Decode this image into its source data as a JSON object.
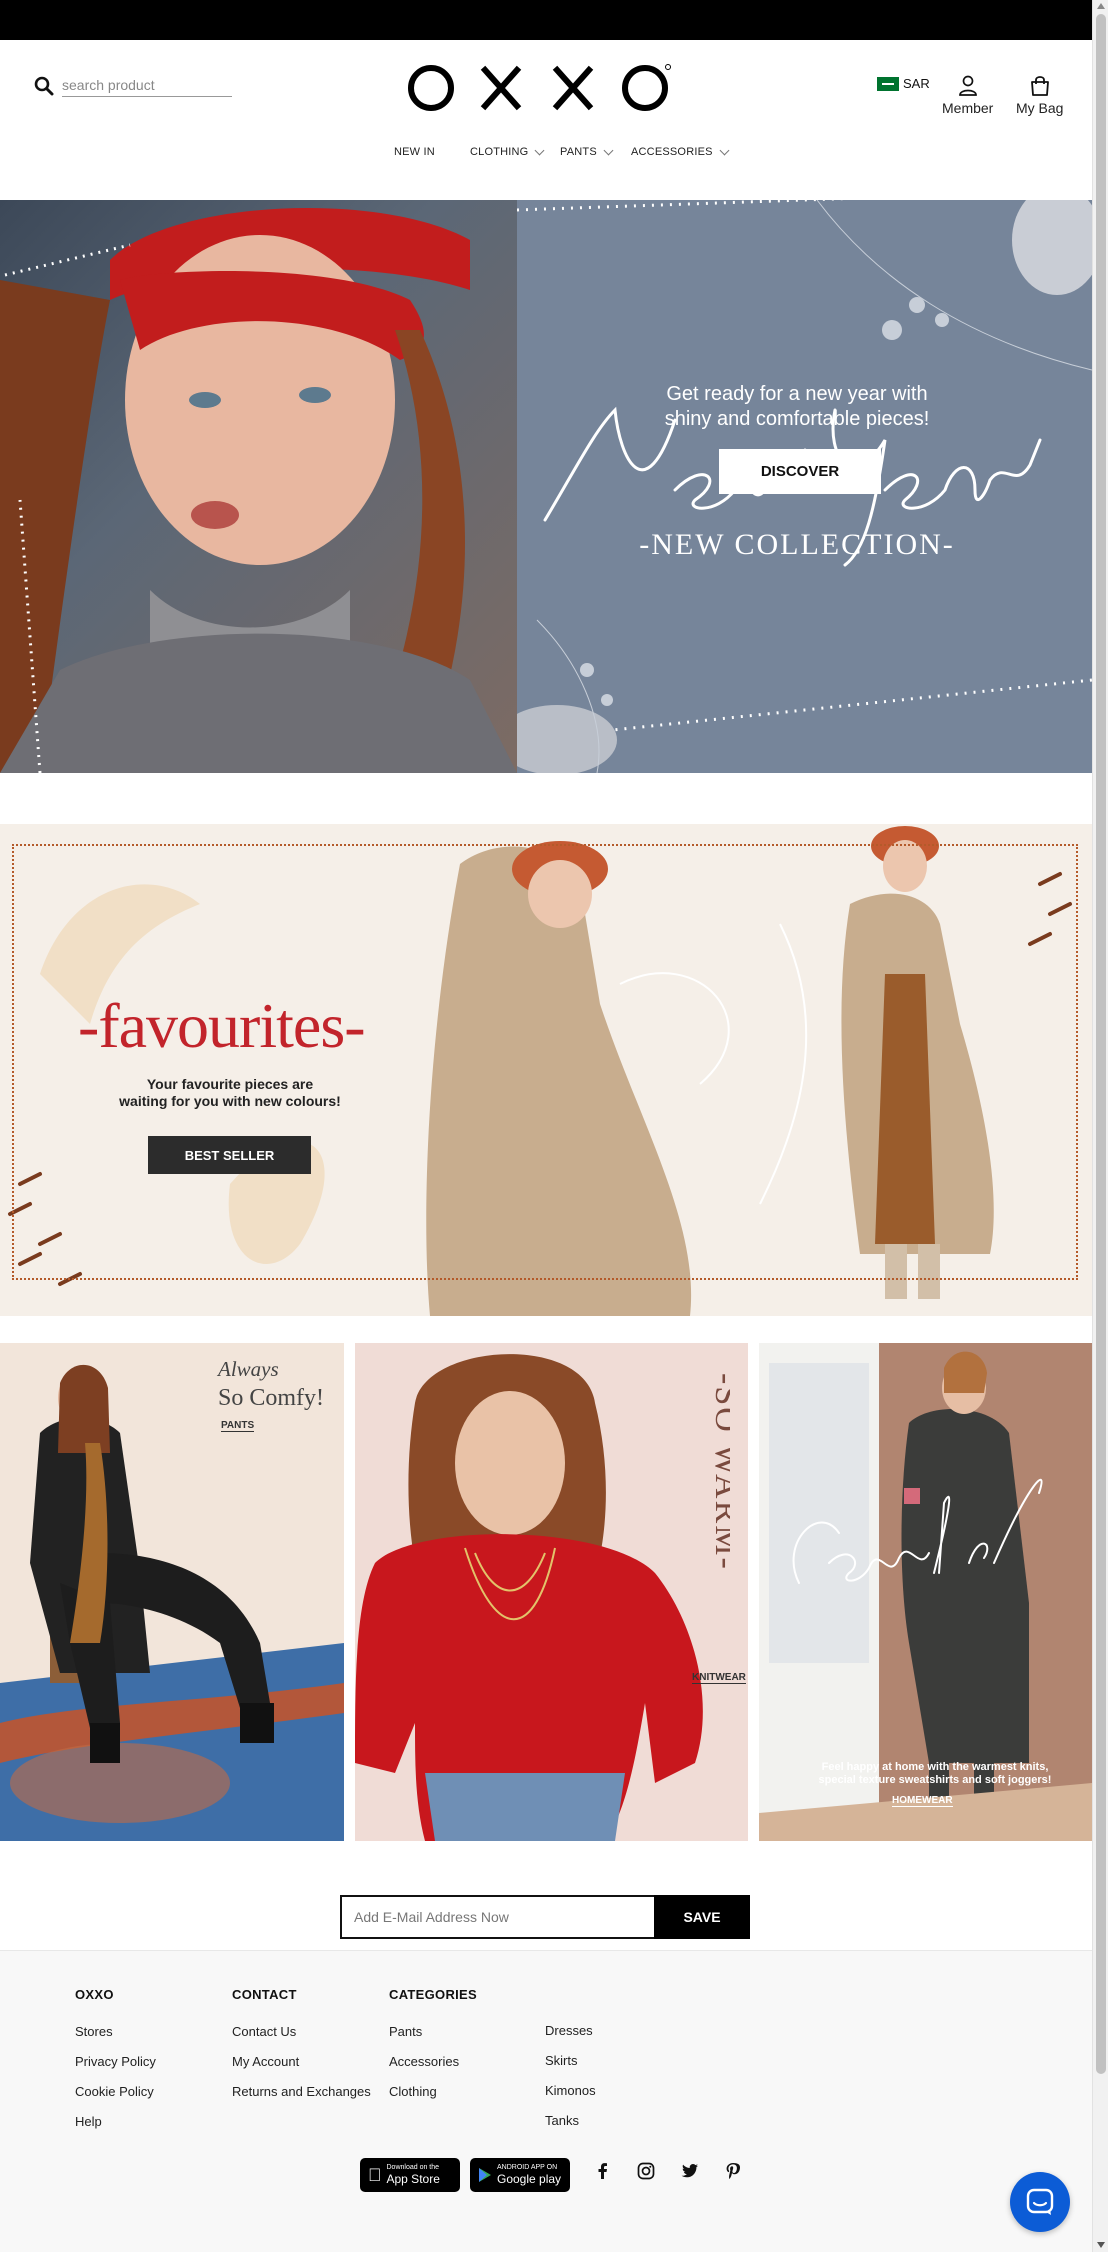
{
  "header": {
    "search_placeholder": "search product",
    "logo_text": "OXXO",
    "currency": "SAR",
    "member_label": "Member",
    "bag_label": "My Bag"
  },
  "nav": {
    "items": [
      {
        "label": "NEW IN",
        "has_menu": false
      },
      {
        "label": "CLOTHING",
        "has_menu": true
      },
      {
        "label": "PANTS",
        "has_menu": true
      },
      {
        "label": "ACCESSORIES",
        "has_menu": true
      }
    ]
  },
  "hero": {
    "script_title": "New Year",
    "collection": "-NEW COLLECTION-",
    "subtitle_line1": "Get ready for a new year with",
    "subtitle_line2": "shiny and comfortable pieces!",
    "button": "DISCOVER"
  },
  "favourites": {
    "title": "-favourites-",
    "subtitle_line1": "Your favourite pieces are",
    "subtitle_line2": "waiting for you with new colours!",
    "button": "BEST SELLER"
  },
  "tiles": {
    "pants": {
      "script": "Always",
      "line2": "So Comfy!",
      "tag": "PANTS"
    },
    "knitwear": {
      "vertical": "-SO WARM-",
      "tag": "KNITWEAR"
    },
    "homewear": {
      "script": "Comfort Zone",
      "text_line1": "Feel happy at home with the warmest knits,",
      "text_line2": "special texture sweatshirts and soft joggers!",
      "tag": "HOMEWEAR"
    }
  },
  "newsletter": {
    "placeholder": "Add E-Mail Address Now",
    "button": "SAVE"
  },
  "footer": {
    "oxxo": {
      "heading": "OXXO",
      "links": [
        "Stores",
        "Privacy Policy",
        "Cookie Policy",
        "Help"
      ]
    },
    "contact": {
      "heading": "CONTACT",
      "links": [
        "Contact Us",
        "My Account",
        "Returns and Exchanges"
      ]
    },
    "categories": {
      "heading": "CATEGORIES",
      "links": [
        "Pants",
        "Accessories",
        "Clothing"
      ]
    },
    "categories2": {
      "links": [
        "Dresses",
        "Skirts",
        "Kimonos",
        "Tanks"
      ]
    },
    "app_store": {
      "small": "Download on the",
      "big": "App Store"
    },
    "google_play": {
      "small": "ANDROID APP ON",
      "big": "Google play"
    }
  },
  "colors": {
    "accent_red": "#c2242b",
    "hero_blue": "#76859a",
    "chat_blue": "#0c5cd6"
  }
}
